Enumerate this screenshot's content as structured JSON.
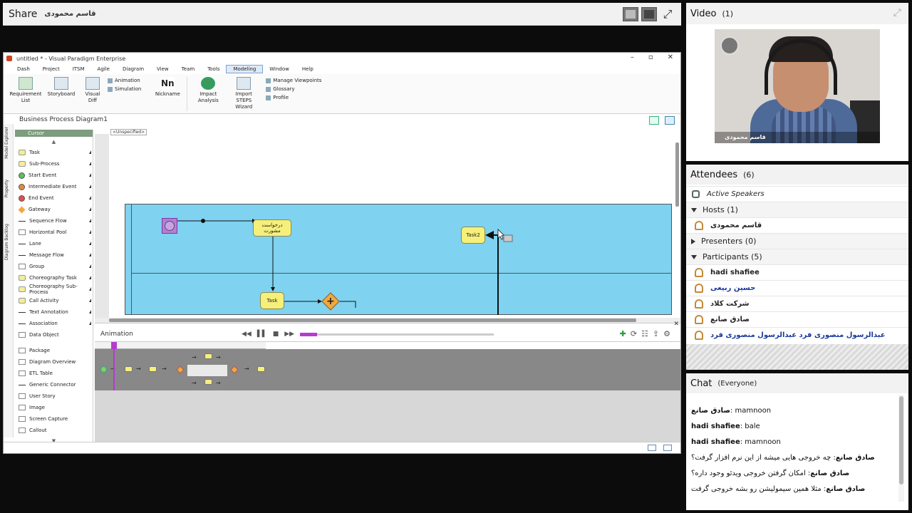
{
  "share": {
    "title": "Share",
    "presenter": "قاسم محمودی"
  },
  "app": {
    "window_title": "untitled * - Visual Paradigm Enterprise",
    "menu": [
      "Dash",
      "Project",
      "ITSM",
      "Agile",
      "Diagram",
      "View",
      "Team",
      "Tools",
      "Modeling",
      "Window",
      "Help"
    ],
    "active_menu": "Modeling",
    "ribbon": {
      "requirement_list": "Requirement List",
      "storyboard": "Storyboard",
      "visual_diff": "Visual Diff",
      "animation": "Animation",
      "simulation": "Simulation",
      "nickname": "Nickname",
      "nickname_icon": "Nn",
      "impact_analysis": "Impact Analysis",
      "import_steps": "Import STEPS Wizard",
      "manage_viewpoints": "Manage Viewpoints",
      "glossary": "Glossary",
      "profile": "Profile"
    },
    "doc_tab": "Business Process Diagram1",
    "side_tabs": [
      "Model Explorer",
      "Property",
      "Diagram Backlog"
    ],
    "palette": {
      "cursor": "Cursor",
      "items": [
        {
          "label": "Task",
          "shape": "task"
        },
        {
          "label": "Sub-Process",
          "shape": "task"
        },
        {
          "label": "Start Event",
          "shape": "circle",
          "color": "#5cc15c"
        },
        {
          "label": "Intermediate Event",
          "shape": "circle",
          "color": "#e38a3a"
        },
        {
          "label": "End Event",
          "shape": "circle",
          "color": "#e05050"
        },
        {
          "label": "Gateway",
          "shape": "diamond",
          "color": "#f0a93e"
        },
        {
          "label": "Sequence Flow",
          "shape": "line"
        },
        {
          "label": "Horizontal Pool",
          "shape": "box"
        },
        {
          "label": "Lane",
          "shape": "line"
        },
        {
          "label": "Message Flow",
          "shape": "line"
        },
        {
          "label": "Group",
          "shape": "box"
        },
        {
          "label": "Choreography Task",
          "shape": "task"
        },
        {
          "label": "Choreography Sub-Process",
          "shape": "task"
        },
        {
          "label": "Call Activity",
          "shape": "task"
        },
        {
          "label": "Text Annotation",
          "shape": "line"
        },
        {
          "label": "Association",
          "shape": "line"
        },
        {
          "label": "Data Object",
          "shape": "box"
        }
      ],
      "items2": [
        {
          "label": "Package",
          "shape": "box"
        },
        {
          "label": "Diagram Overview",
          "shape": "box"
        },
        {
          "label": "ETL Table",
          "shape": "box"
        },
        {
          "label": "Generic Connector",
          "shape": "line"
        },
        {
          "label": "User Story",
          "shape": "box"
        },
        {
          "label": "Image",
          "shape": "box"
        },
        {
          "label": "Screen Capture",
          "shape": "box"
        },
        {
          "label": "Callout",
          "shape": "box"
        }
      ]
    },
    "canvas": {
      "unspecified": "<Unspecified>",
      "task_request": "درخواست مشورت",
      "task2": "Task2",
      "task": "Task",
      "gateway_symbol": "+"
    },
    "animation": {
      "title": "Animation",
      "progress": 0.09,
      "controls": [
        "◀◀",
        "▌▌",
        "■",
        "▶▶"
      ]
    }
  },
  "video": {
    "title": "Video",
    "count": "(1)",
    "name": "قاسم محمودی"
  },
  "attendees": {
    "title": "Attendees",
    "count": "(6)",
    "active_speakers": "Active Speakers",
    "hosts": "Hosts (1)",
    "host_list": [
      "قاسم محمودی"
    ],
    "presenters": "Presenters (0)",
    "participants": "Participants (5)",
    "participant_list": [
      {
        "name": "hadi shafiee",
        "style": "bold"
      },
      {
        "name": "حسین ربیعی",
        "style": "blue"
      },
      {
        "name": "شرکت کلاد",
        "style": "bold"
      },
      {
        "name": "صادق صانع",
        "style": "bold"
      },
      {
        "name": "عبدالرسول منصوری فرد عبدالرسول منصوری فرد",
        "style": "blue"
      }
    ]
  },
  "chat": {
    "title": "Chat",
    "scope": "(Everyone)",
    "messages": [
      {
        "sender": "صادق صانع",
        "text": "mamnoon"
      },
      {
        "sender": "hadi shafiee",
        "text": "bale"
      },
      {
        "sender": "hadi shafiee",
        "text": "mamnoon"
      },
      {
        "sender": "صادق صانع",
        "text": "چه خروجی هایی میشه از این نرم افزار گرفت؟"
      },
      {
        "sender": "صادق صانع",
        "text": "امکان گرفتن خروجی ویدئو وجود داره؟"
      },
      {
        "sender": "صادق صانع",
        "text": "مثلا همین سیمولیشن رو بشه خروجی گرفت"
      }
    ]
  }
}
